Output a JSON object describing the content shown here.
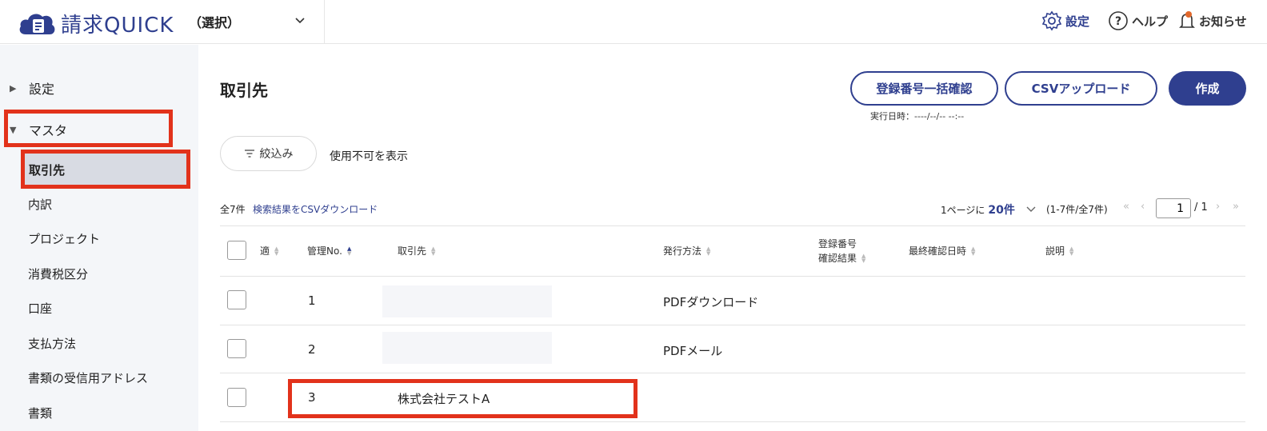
{
  "header": {
    "app_name": "請求QUICK",
    "company_selector": "（選択）",
    "nav": {
      "settings": "設定",
      "help": "ヘルプ",
      "notice": "お知らせ"
    }
  },
  "sidebar": {
    "settings_label": "設定",
    "master_label": "マスタ",
    "items": [
      "取引先",
      "内訳",
      "プロジェクト",
      "消費税区分",
      "口座",
      "支払方法",
      "書類の受信用アドレス",
      "書類"
    ]
  },
  "main": {
    "title": "取引先",
    "buttons": {
      "bulk_check": "登録番号一括確認",
      "csv_upload": "CSVアップロード",
      "create": "作成"
    },
    "exec_time": "実行日時：----/--/-- --:--",
    "filter_label": "絞込み",
    "show_disabled_label": "使用不可を表示",
    "total": "全7件",
    "csv_download": "検索結果をCSVダウンロード",
    "per_page_prefix": "1ページに",
    "per_page_value": "20件",
    "range": "(1-7件/全7件)",
    "current_page": "1",
    "page_total": "/ 1"
  },
  "table": {
    "headers": {
      "tekikaku": "適",
      "management_no": "管理No.",
      "partner": "取引先",
      "issue_method": "発行方法",
      "reg_check_1": "登録番号",
      "reg_check_2": "確認結果",
      "last_checked": "最終確認日時",
      "description": "説明"
    },
    "rows": [
      {
        "no": "1",
        "partner": "",
        "method": "PDFダウンロード"
      },
      {
        "no": "2",
        "partner": "",
        "method": "PDFメール"
      },
      {
        "no": "3",
        "partner": "株式会社テストA",
        "method": ""
      }
    ]
  },
  "colors": {
    "brand": "#2f3f8f",
    "highlight": "#e2321b",
    "sidebar_bg": "#f4f6f9"
  }
}
